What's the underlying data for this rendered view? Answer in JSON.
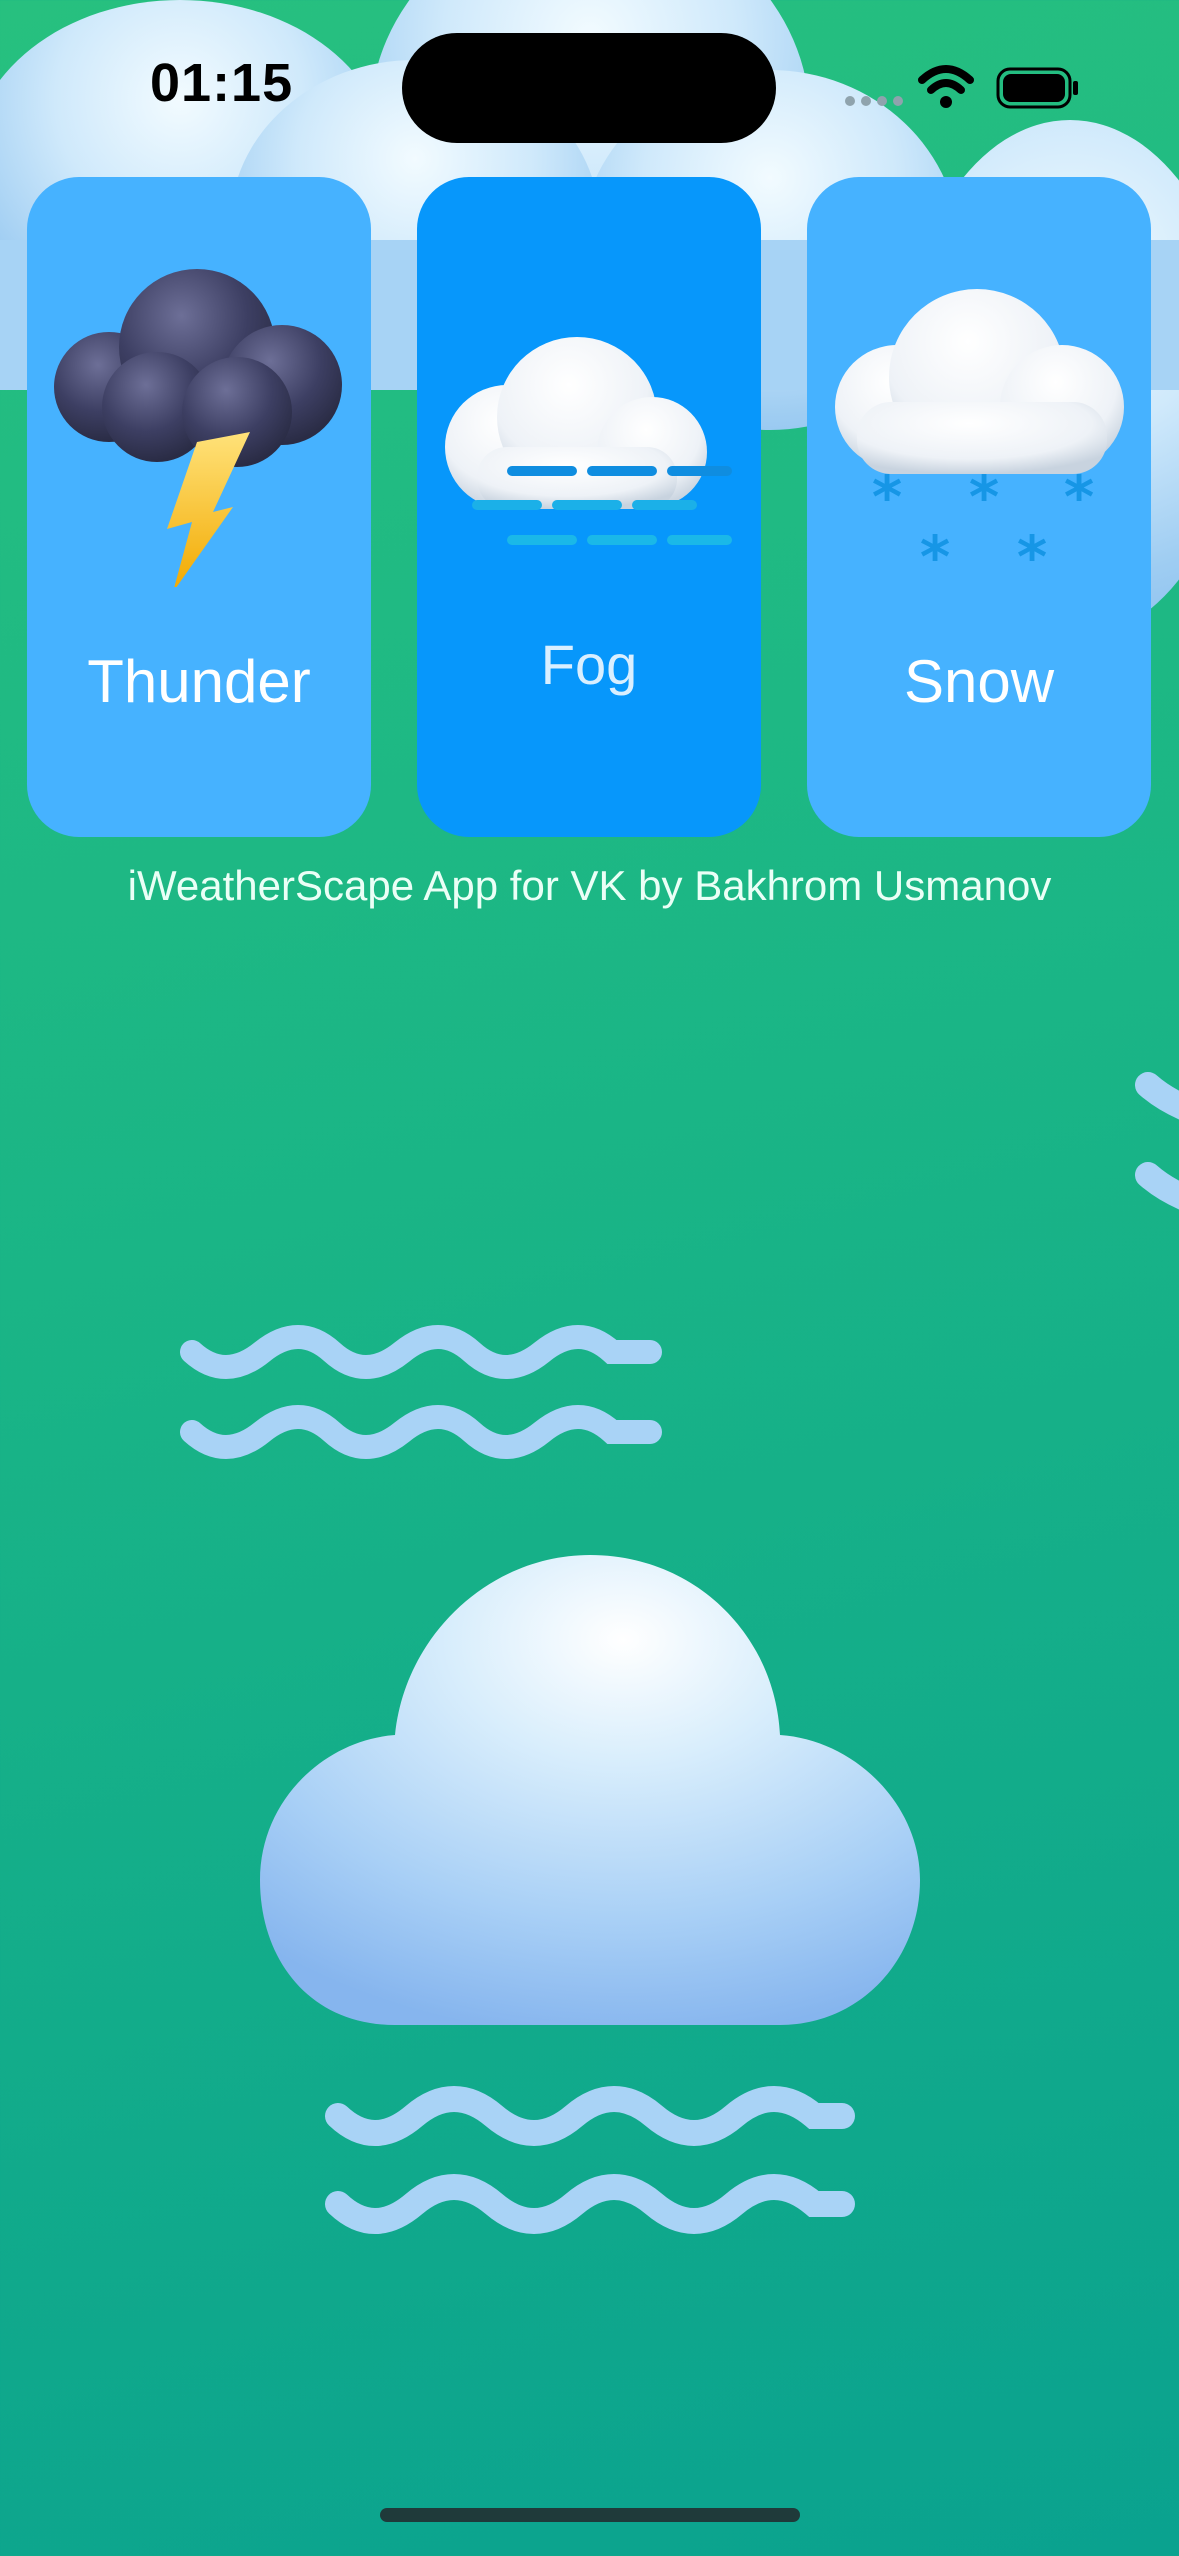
{
  "status_bar": {
    "time": "01:15"
  },
  "cards": [
    {
      "label": "Thunder",
      "icon": "thunder-cloud-icon"
    },
    {
      "label": "Fog",
      "icon": "fog-cloud-icon",
      "selected": true
    },
    {
      "label": "Snow",
      "icon": "snow-cloud-icon"
    }
  ],
  "credit": "iWeatherScape App for VK by Bakhrom Usmanov",
  "colors": {
    "background_top": "#27c07f",
    "background_bottom": "#0aa28f",
    "card": "#46b2ff",
    "card_selected": "#0797fb"
  }
}
